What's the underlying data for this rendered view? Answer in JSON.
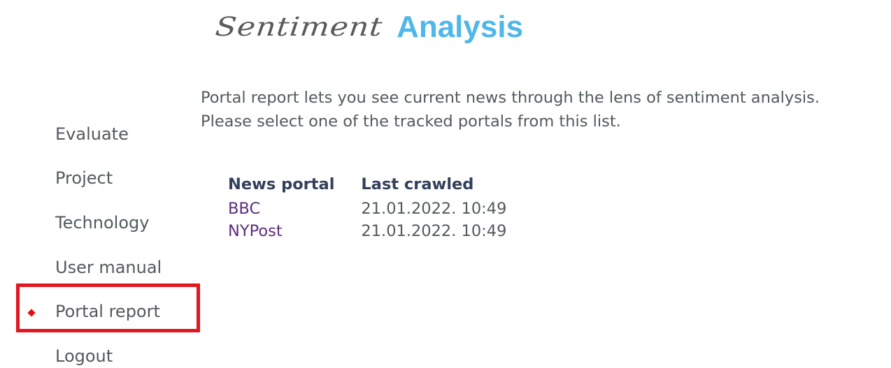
{
  "header": {
    "brand_script": "Sentiment",
    "brand_bold": "Analysis"
  },
  "sidebar": {
    "items": [
      {
        "label": "Evaluate",
        "active": false
      },
      {
        "label": "Project",
        "active": false
      },
      {
        "label": "Technology",
        "active": false
      },
      {
        "label": "User manual",
        "active": false
      },
      {
        "label": "Portal report",
        "active": true
      },
      {
        "label": "Logout",
        "active": false
      }
    ]
  },
  "main": {
    "intro_line1": "Portal report lets you see current news through the lens of sentiment analysis.",
    "intro_line2": "Please select one of the tracked portals from this list.",
    "table": {
      "headers": [
        "News portal",
        "Last crawled"
      ],
      "rows": [
        {
          "portal": "BBC",
          "last_crawled": "21.01.2022. 10:49"
        },
        {
          "portal": "NYPost",
          "last_crawled": "21.01.2022. 10:49"
        }
      ]
    }
  },
  "colors": {
    "brand_accent": "#4fb7ea",
    "text": "#54595f",
    "header_text": "#33405a",
    "link": "#5c2c7d",
    "active_bullet": "#e01010",
    "highlight_border": "#e3151f"
  },
  "icons": {
    "active_bullet": "diamond-bullet-icon"
  }
}
